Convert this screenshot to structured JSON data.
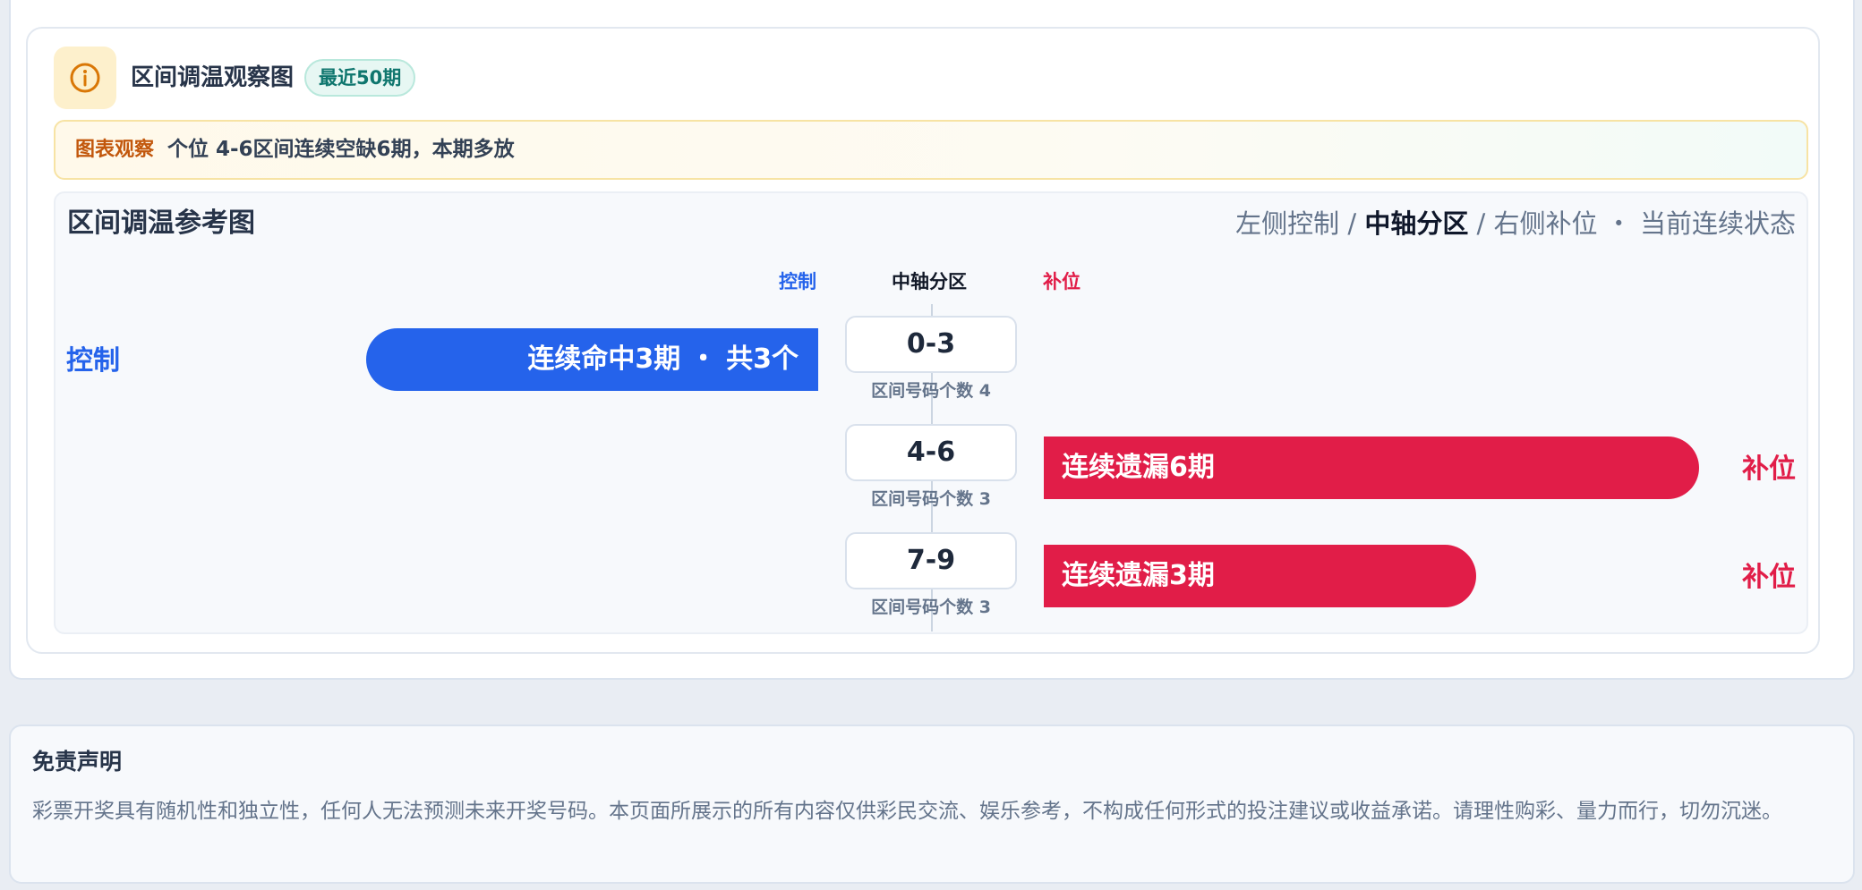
{
  "header": {
    "title": "区间调温观察图",
    "badge": "最近50期",
    "icon": "info-icon",
    "icon_color": "#d97706"
  },
  "observation": {
    "label": "图表观察",
    "text": "个位 4-6区间连续空缺6期，本期多放"
  },
  "chart": {
    "title": "区间调温参考图",
    "legend": {
      "left": "左侧控制 / ",
      "center": "中轴分区",
      "right": " / 右侧补位 ・ 当前连续状态"
    },
    "columns": {
      "control": "控制",
      "axis": "中轴分区",
      "fill": "补位"
    },
    "colors": {
      "control": "#2563eb",
      "fill": "#e11d48"
    },
    "rows": [
      {
        "range": "0-3",
        "count_label": "区间号码个数 4",
        "side": "control",
        "side_label": "控制",
        "bar_text": "连续命中3期 ・ 共3个",
        "streak": 3
      },
      {
        "range": "4-6",
        "count_label": "区间号码个数 3",
        "side": "fill",
        "side_label": "补位",
        "bar_text": "连续遗漏6期",
        "streak": 6
      },
      {
        "range": "7-9",
        "count_label": "区间号码个数 3",
        "side": "fill",
        "side_label": "补位",
        "bar_text": "连续遗漏3期",
        "streak": 3
      }
    ]
  },
  "disclaimer": {
    "title": "免责声明",
    "text": "彩票开奖具有随机性和独立性，任何人无法预测未来开奖号码。本页面所展示的所有内容仅供彩民交流、娱乐参考，不构成任何形式的投注建议或收益承诺。请理性购彩、量力而行，切勿沉迷。"
  }
}
